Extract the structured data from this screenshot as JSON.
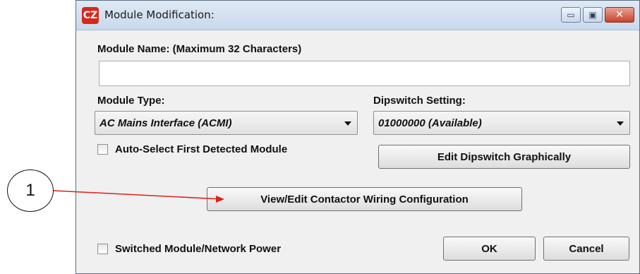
{
  "window": {
    "title": "Module Modification:",
    "app_icon_text": "CZ",
    "minimize_glyph": "▭",
    "maximize_glyph": "▣",
    "close_glyph": "✕"
  },
  "form": {
    "module_name_label": "Module Name: (Maximum 32 Characters)",
    "module_name_value": "",
    "module_type_label": "Module Type:",
    "module_type_value": "AC Mains Interface (ACMI)",
    "dipswitch_label": "Dipswitch Setting:",
    "dipswitch_value": "01000000 (Available)",
    "auto_select_label": "Auto-Select First Detected Module",
    "auto_select_checked": false,
    "edit_dipswitch_button": "Edit Dipswitch Graphically",
    "contactor_button": "View/Edit Contactor Wiring Configuration",
    "switched_power_label": "Switched Module/Network Power",
    "switched_power_checked": false,
    "ok_button": "OK",
    "cancel_button": "Cancel"
  },
  "annotation": {
    "callout_number": "1",
    "arrow_color": "#e0201a"
  },
  "colors": {
    "close_button": "#c8432c",
    "titlebar": "#dfe9f5",
    "app_icon": "#d8271c"
  }
}
